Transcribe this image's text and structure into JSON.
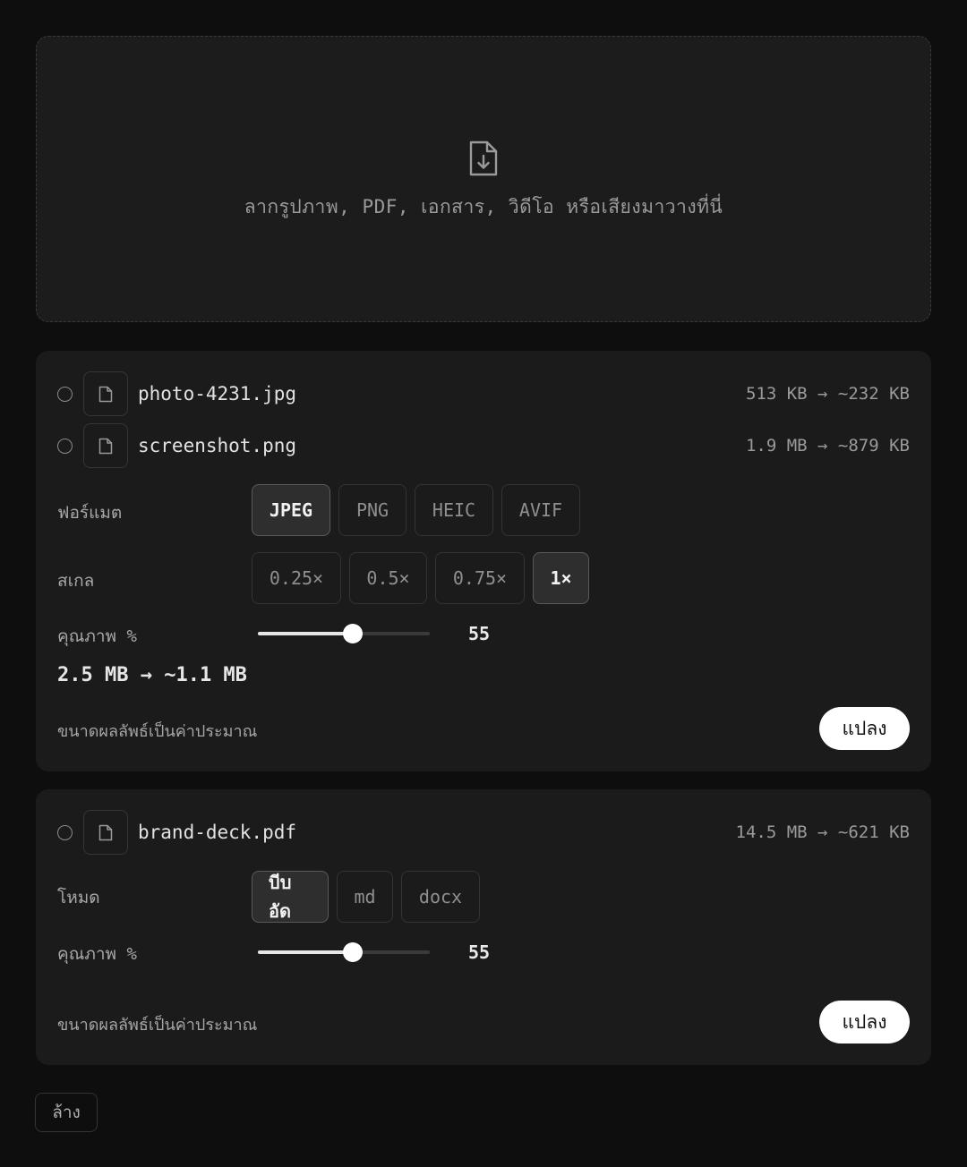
{
  "dropzone": {
    "icon": "file-download-icon",
    "text": "ลากรูปภาพ, PDF, เอกสาร, วิดีโอ หรือเสียงมาวางที่นี่"
  },
  "image_group": {
    "files": [
      {
        "name": "photo-4231.jpg",
        "size": "513 KB → ~232 KB",
        "icon": "file-icon"
      },
      {
        "name": "screenshot.png",
        "size": "1.9 MB → ~879 KB",
        "icon": "file-icon"
      }
    ],
    "format_label": "ฟอร์แมต",
    "formats": [
      "JPEG",
      "PNG",
      "HEIC",
      "AVIF"
    ],
    "format_selected": "JPEG",
    "scale_label": "สเกล",
    "scales": [
      "0.25×",
      "0.5×",
      "0.75×",
      "1×"
    ],
    "scale_selected": "1×",
    "quality_label": "คุณภาพ %",
    "quality_value": "55",
    "quality_fraction": 0.55,
    "total": "2.5 MB → ~1.1 MB",
    "note": "ขนาดผลลัพธ์เป็นค่าประมาณ",
    "convert_label": "แปลง"
  },
  "pdf_group": {
    "file": {
      "name": "brand-deck.pdf",
      "size": "14.5 MB → ~621 KB",
      "icon": "file-icon"
    },
    "mode_label": "โหมด",
    "modes": [
      "บีบอัด",
      "md",
      "docx"
    ],
    "mode_selected": "บีบอัด",
    "quality_label": "คุณภาพ %",
    "quality_value": "55",
    "quality_fraction": 0.55,
    "note": "ขนาดผลลัพธ์เป็นค่าประมาณ",
    "convert_label": "แปลง"
  },
  "clear_label": "ล้าง",
  "colors": {
    "background": "#0e0e0e",
    "card": "#1b1b1b",
    "accent": "#ffffff"
  }
}
